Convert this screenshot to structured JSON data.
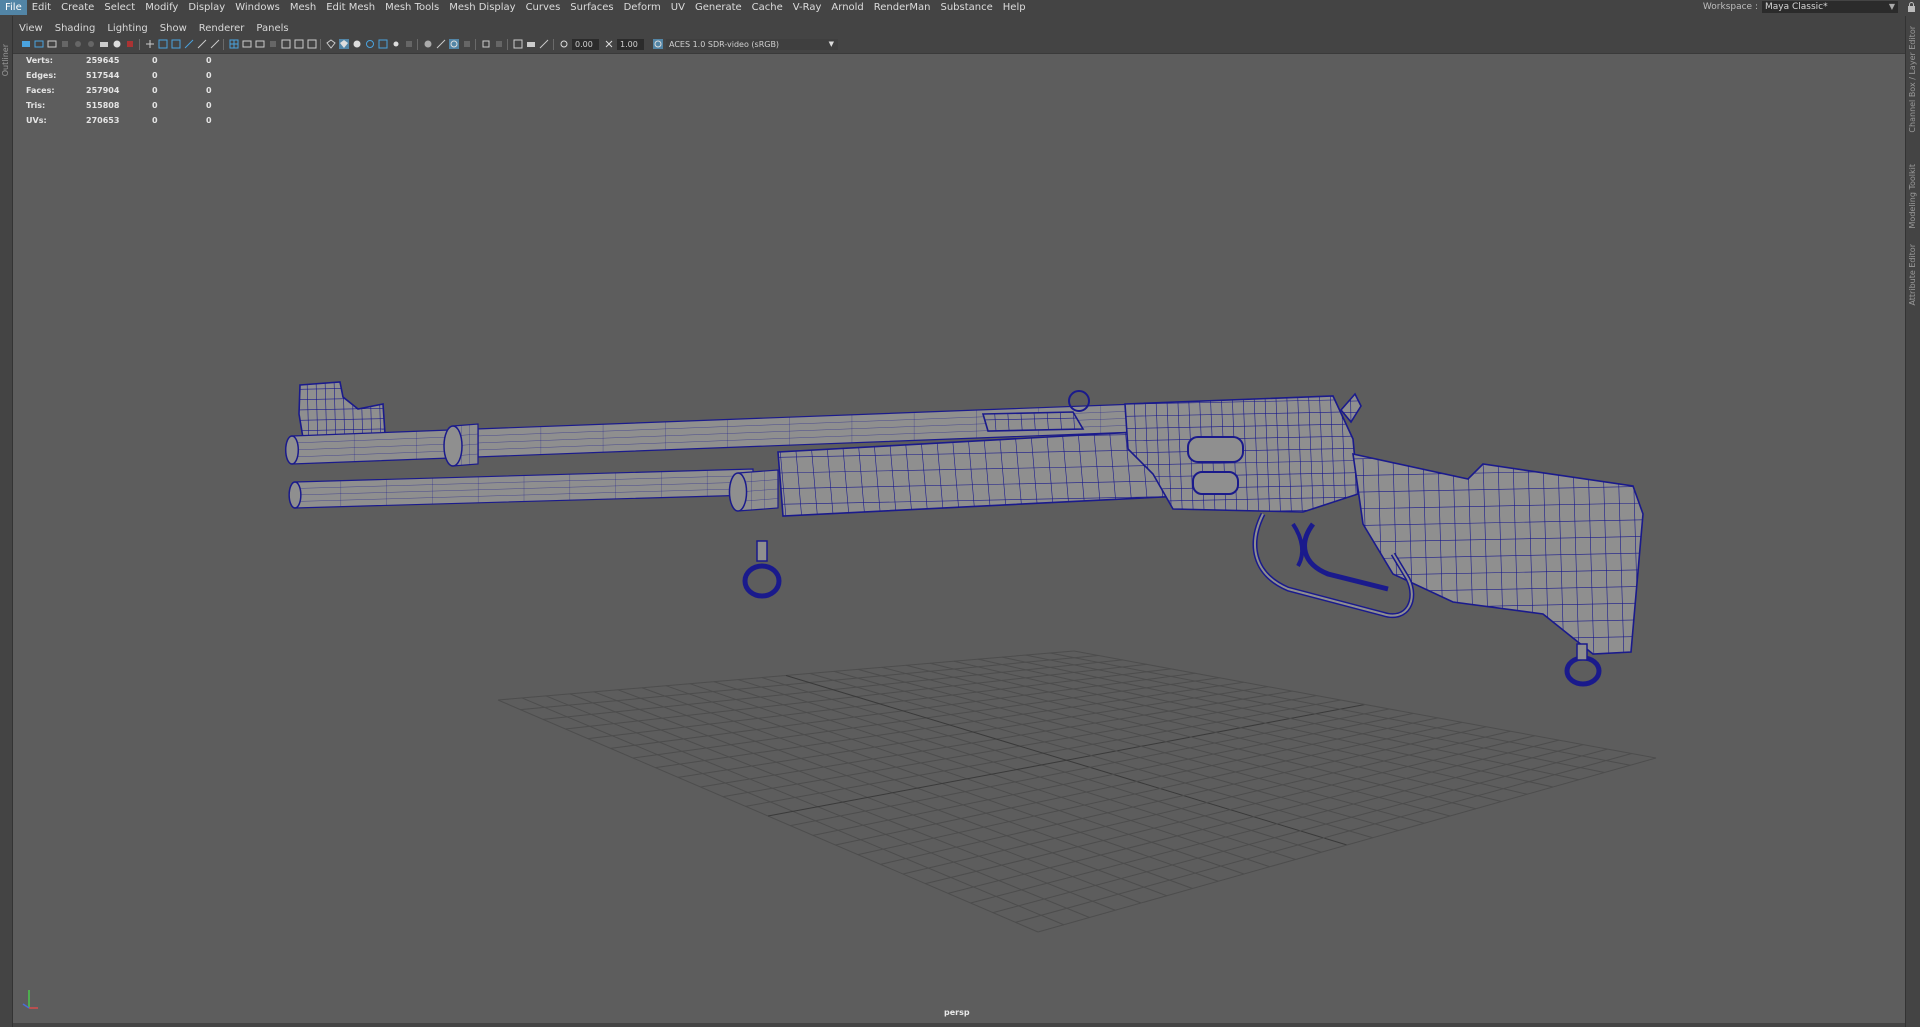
{
  "menu_bar": {
    "items": [
      {
        "label": "File",
        "active": true
      },
      {
        "label": "Edit"
      },
      {
        "label": "Create"
      },
      {
        "label": "Select"
      },
      {
        "label": "Modify"
      },
      {
        "label": "Display"
      },
      {
        "label": "Windows"
      },
      {
        "label": "Mesh"
      },
      {
        "label": "Edit Mesh"
      },
      {
        "label": "Mesh Tools"
      },
      {
        "label": "Mesh Display"
      },
      {
        "label": "Curves"
      },
      {
        "label": "Surfaces"
      },
      {
        "label": "Deform"
      },
      {
        "label": "UV"
      },
      {
        "label": "Generate"
      },
      {
        "label": "Cache"
      },
      {
        "label": "V-Ray"
      },
      {
        "label": "Arnold"
      },
      {
        "label": "RenderMan"
      },
      {
        "label": "Substance"
      },
      {
        "label": "Help"
      }
    ],
    "workspace_label": "Workspace :",
    "workspace_value": "Maya Classic*"
  },
  "left_tabs": {
    "outliner": "Outliner"
  },
  "right_tabs": {
    "channel_box": "Channel Box / Layer Editor",
    "modeling_toolkit": "Modeling Toolkit",
    "attribute_editor": "Attribute Editor"
  },
  "panel_menu": [
    "View",
    "Shading",
    "Lighting",
    "Show",
    "Renderer",
    "Panels"
  ],
  "toolbar": {
    "exposure": "0.00",
    "gamma": "1.00",
    "color_space": "ACES 1.0 SDR-video (sRGB)"
  },
  "hud": [
    {
      "label": "Verts:",
      "value": "259645",
      "selected": "0",
      "sel_extra": "0"
    },
    {
      "label": "Edges:",
      "value": "517544",
      "selected": "0",
      "sel_extra": "0"
    },
    {
      "label": "Faces:",
      "value": "257904",
      "selected": "0",
      "sel_extra": "0"
    },
    {
      "label": "Tris:",
      "value": "515808",
      "selected": "0",
      "sel_extra": "0"
    },
    {
      "label": "UVs:",
      "value": "270653",
      "selected": "0",
      "sel_extra": "0"
    }
  ],
  "camera": "persp",
  "colors": {
    "wireframe": "#1a1a8c",
    "mesh_fill": "#8f8f8f",
    "viewport_bg": "#5d5d5d",
    "active_menu": "#5285a6"
  }
}
